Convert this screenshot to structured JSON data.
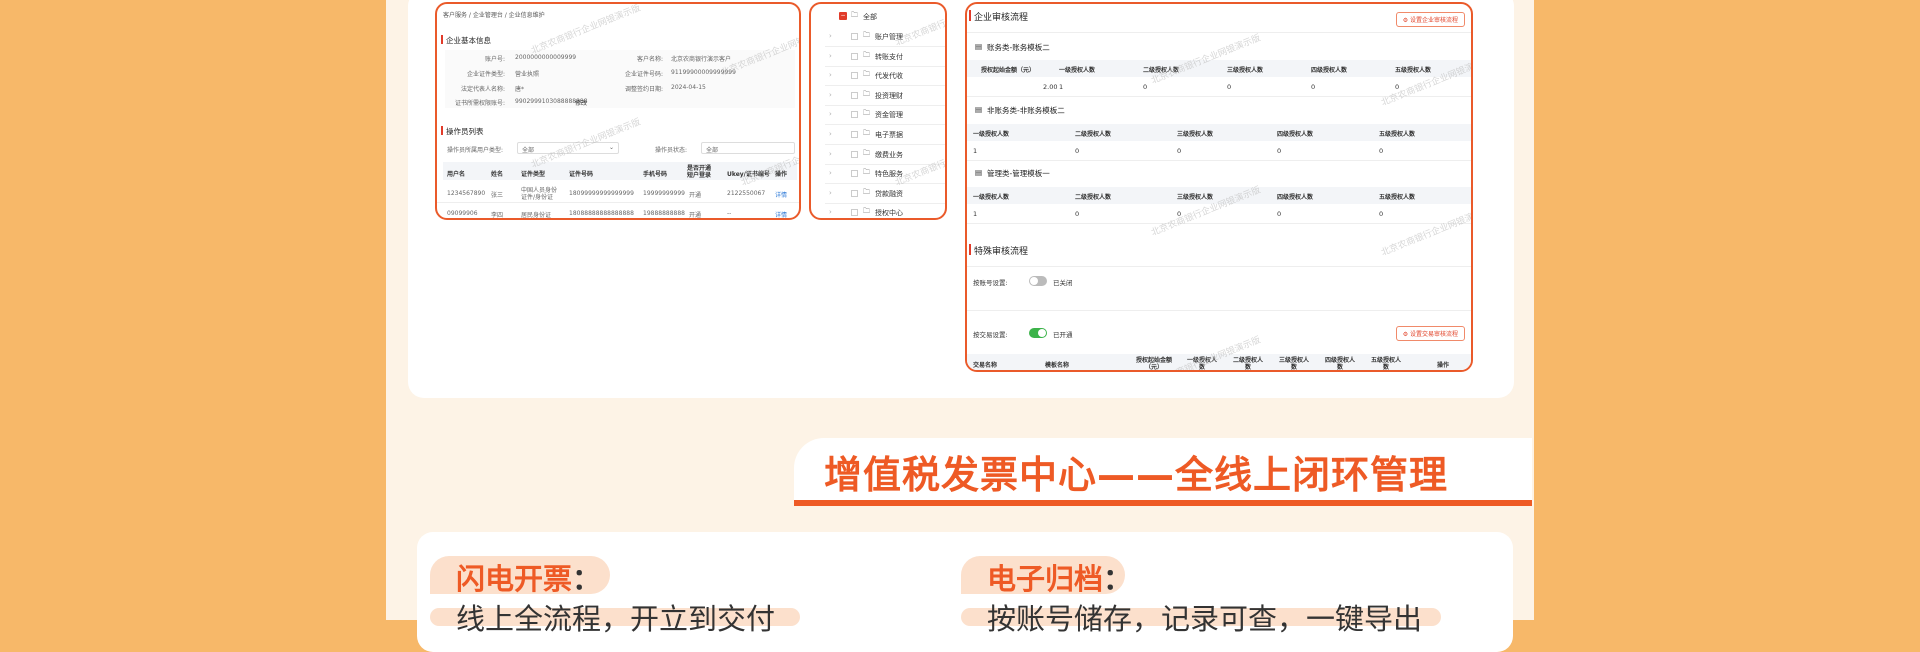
{
  "colors": {
    "accent": "#ee5a25",
    "red": "#e13b2a",
    "green": "#3cb34a",
    "tag_bg": "#fce0cc"
  },
  "watermark": "北京农商银行企业网银演示版",
  "s1": {
    "breadcrumb": "客户服务 / 企业管理台 / 企业信息维护",
    "info_title": "企业基本信息",
    "fields": [
      {
        "label": "账户号:",
        "value": "2000000000009999"
      },
      {
        "label": "客户名称:",
        "value": "北京农商银行演示客户"
      },
      {
        "label": "企业证件类型:",
        "value": "营业执照"
      },
      {
        "label": "企业证件号码:",
        "value": "91199900009999999"
      },
      {
        "label": "法定代表人名称:",
        "value": "唐*"
      },
      {
        "label": "调整签约日期:",
        "value": "2024-04-15"
      },
      {
        "label": "证书所需权限账号:",
        "value": "9902999103088888888"
      },
      {
        "label": "",
        "value": "修改"
      }
    ],
    "op_title": "操作员列表",
    "filter1_label": "操作员所属用户类型:",
    "filter1_value": "全部",
    "filter2_label": "操作员状态:",
    "filter2_value": "全部",
    "columns": [
      "用户名",
      "姓名",
      "证件类型",
      "证件号码",
      "手机号码",
      "是否开通短户登录",
      "Ukey/证书编号",
      "操作"
    ],
    "rows": [
      [
        "1234567890",
        "张三",
        "中国人员身份证件/身份证",
        "18099999999999999",
        "19999999999",
        "开通",
        "2122550067",
        "详情"
      ],
      [
        "09099906",
        "李四",
        "居民身份证",
        "18088888888888888",
        "19888888888",
        "开通",
        "--",
        "详情"
      ]
    ]
  },
  "s2": {
    "root": "全部",
    "items": [
      "账户管理",
      "转账支付",
      "代发代收",
      "投资理财",
      "资金管理",
      "电子票据",
      "缴费业务",
      "特色服务",
      "贷款融资",
      "授权中心"
    ]
  },
  "s3": {
    "title": "企业审核流程",
    "set_btn": "设置企业审核流程",
    "g1": {
      "title": "账务类-账务模板二",
      "cols": [
        "授权起始金额（元）",
        "一级授权人数",
        "二级授权人数",
        "三级授权人数",
        "四级授权人数",
        "五级授权人数"
      ],
      "row": [
        "2.00",
        "1",
        "0",
        "0",
        "0",
        "0"
      ]
    },
    "g2": {
      "title": "非账务类-非账务模板二",
      "cols": [
        "一级授权人数",
        "二级授权人数",
        "三级授权人数",
        "四级授权人数",
        "五级授权人数"
      ],
      "row": [
        "1",
        "0",
        "0",
        "0",
        "0"
      ]
    },
    "g3": {
      "title": "管理类-管理模板一",
      "cols": [
        "一级授权人数",
        "二级授权人数",
        "三级授权人数",
        "四级授权人数",
        "五级授权人数"
      ],
      "row": [
        "1",
        "0",
        "0",
        "0",
        "0"
      ]
    },
    "special_title": "特殊审核流程",
    "acct_label": "按账号设置:",
    "acct_state": "已关闭",
    "trade_label": "按交易设置:",
    "trade_state": "已开通",
    "trade_btn": "设置交易审核流程",
    "trade_cols": [
      "交易名称",
      "模板名称",
      "授权起始金额（元）",
      "一级授权人数",
      "二级授权人数",
      "三级授权人数",
      "四级授权人数",
      "五级授权人数",
      "操作"
    ]
  },
  "banner": {
    "title": "增值税发票中心——全线上闭环管理"
  },
  "features": [
    {
      "title": "闪电开票",
      "colon": "：",
      "subtitle": "线上全流程，开立到交付"
    },
    {
      "title": "电子归档",
      "colon": "：",
      "subtitle": "按账号储存，记录可查，一键导出"
    }
  ]
}
